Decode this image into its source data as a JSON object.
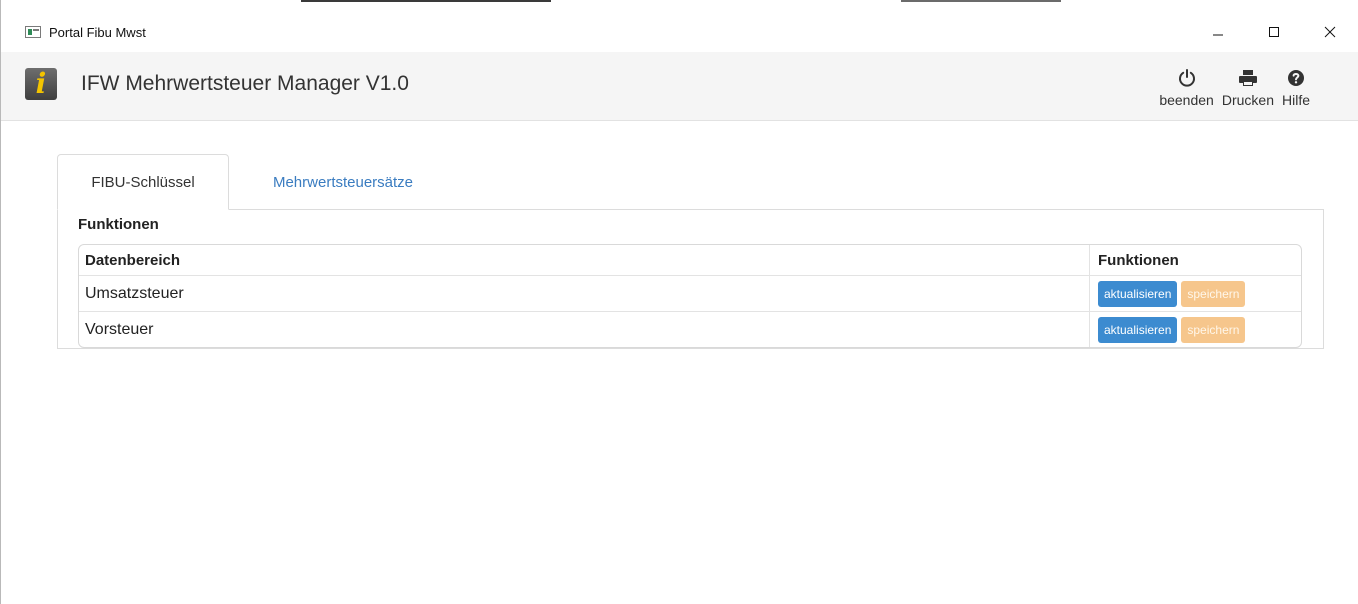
{
  "window": {
    "title": "Portal Fibu Mwst",
    "controls": {
      "minimize_icon": "minimize-icon",
      "maximize_icon": "maximize-icon",
      "close_icon": "close-icon"
    }
  },
  "header": {
    "logo_text": "i",
    "app_title": "IFW Mehrwertsteuer Manager V1.0",
    "actions": [
      {
        "label": "beenden",
        "icon": "power-icon"
      },
      {
        "label": "Drucken",
        "icon": "printer-icon"
      },
      {
        "label": "Hilfe",
        "icon": "help-icon"
      }
    ]
  },
  "tabs": [
    {
      "label": "FIBU-Schlüssel",
      "active": true
    },
    {
      "label": "Mehrwertsteuersätze",
      "active": false
    }
  ],
  "panel": {
    "section_title": "Funktionen",
    "table": {
      "columns": [
        "Datenbereich",
        "Funktionen"
      ],
      "rows": [
        {
          "datenbereich": "Umsatzsteuer",
          "btn_update": "aktualisieren",
          "btn_save": "speichern"
        },
        {
          "datenbereich": "Vorsteuer",
          "btn_update": "aktualisieren",
          "btn_save": "speichern"
        }
      ]
    }
  },
  "colors": {
    "primary": "#3c8bd0",
    "warning": "#f6c68c",
    "link": "#3a7cc0",
    "logo_accent": "#f3c400"
  }
}
